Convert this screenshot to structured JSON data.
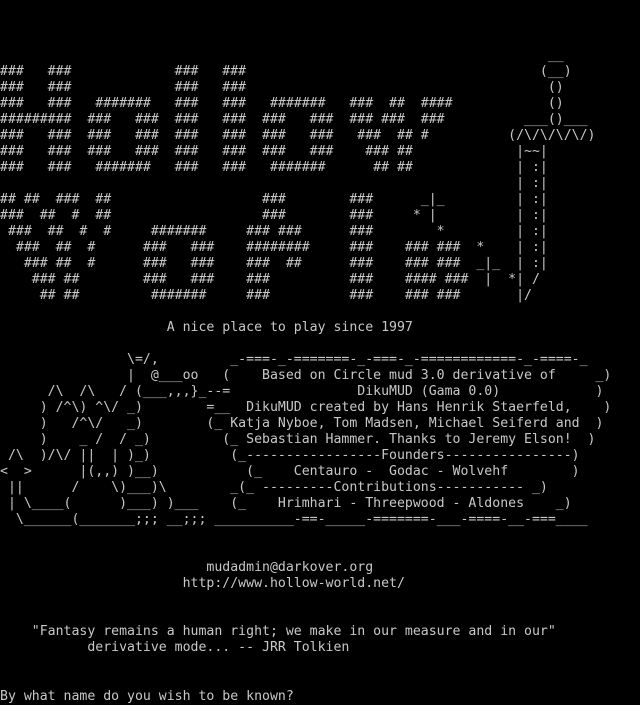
{
  "terminal": {
    "background": "#000000",
    "foreground": "#c8c8c8",
    "lines": [
      "",
      "",
      "",
      "                                                                     __",
      "###   ###             ###   ###                                     (__)",
      "###   ###             ###   ###                                      ()",
      "###   ###   #######   ###   ###   #######   ###  ##  ####            ()",
      "#########  ###   ###  ###   ###  ###   ###  ### ###  ###          ___()___",
      "###   ###  ###   ###  ###   ###  ###   ###   ###  ## #          (/\\/\\/\\/\\/)",
      "###   ###  ###   ###  ###   ###  ###   ###    ### ##             |~~|",
      "###   ###   #######   ###   ###   #######      ## ##             | :|",
      "                                                                 | :|",
      "## ##  ###  ##                   ###        ###      _|_         | :|",
      "###  ##  #  ##                   ###        ###     * |          | :|",
      " ###  ##  #  #     #######     ### ###      ###        *         | :|",
      "  ###  ##  #      ###   ###    ########     ###    ### ###  *    | :|",
      "   ### ##  #      ###   ###    ###  ##      ###    ### ###  _|_  | :|",
      "    ### ##        ###   ###    ###          ###    #### ###  |  *| /",
      "     ## ##         #######     ###          ###    ### ###       |/",
      "",
      "                     A nice place to play since 1997",
      "",
      "                \\=/,         _-===-_-=======-_-===-_-============-_-====-_",
      "                |  @___oo   (    Based on Circle mud 3.0 derivative of     _)",
      "      /\\  /\\   / (___,,,}_--=                DikuMUD (Gama 0.0)            )",
      "     ) /^\\) ^\\/ _)        =__  DikuMUD created by Hans Henrik Staerfeld,    )",
      "     )   /^\\/   _)        (_ Katja Nyboe, Tom Madsen, Michael Seiferd and  )",
      "     )    _ /  / _)         (_ Sebastian Hammer. Thanks to Jeremy Elson!  )",
      " /\\  )/\\/ ||  | )_)          (_-----------------Founders----------------)",
      "<  >      |(,,) )__)           (_    Centauro -  Godac - Wolvehf        )",
      " ||      /    \\)___)\\        _(_ ---------Contributions----------- _)",
      " | \\____(      )___) )___    (_    Hrimhari - Threepwood - Aldones    _)",
      "  \\______(_______;;; __;;; __________-==-_____-=======-___-====-__-===____",
      "",
      "",
      "                          mudadmin@darkover.org",
      "                       http://www.hollow-world.net/",
      "",
      "",
      "    \"Fantasy remains a human right; we make in our measure and in our\"",
      "           derivative mode... -- JRR Tolkien",
      "",
      ""
    ],
    "prompt": "By what name do you wish to be known?"
  }
}
